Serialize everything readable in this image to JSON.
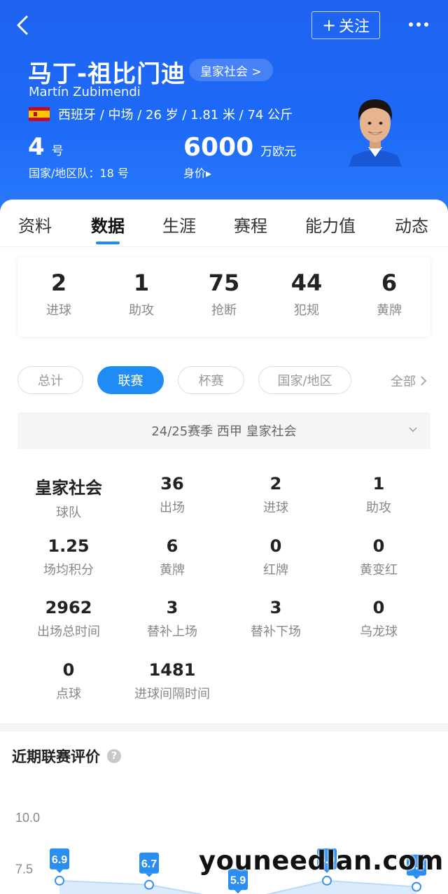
{
  "header": {
    "follow_label": "关注",
    "name_cn": "马丁-祖比门迪",
    "club_chip": "皇家社会 >",
    "name_en": "Martín Zubimendi",
    "bio": "西班牙 / 中场 / 26 岁 / 1.81 米 / 74 公斤",
    "shirt_number": "4",
    "shirt_unit": "号",
    "national_team": "国家/地区队：18 号",
    "market_value": "6000",
    "market_value_unit": "万欧元",
    "market_value_label": "身价▸",
    "colors": {
      "bg": "#1d6af7",
      "accent": "#1f8cf6"
    }
  },
  "tabs": [
    "资料",
    "数据",
    "生涯",
    "赛程",
    "能力值",
    "动态"
  ],
  "active_tab": "数据",
  "summary": [
    {
      "value": "2",
      "label": "进球"
    },
    {
      "value": "1",
      "label": "助攻"
    },
    {
      "value": "75",
      "label": "抢断"
    },
    {
      "value": "44",
      "label": "犯规"
    },
    {
      "value": "6",
      "label": "黄牌"
    }
  ],
  "filters": [
    "总计",
    "联赛",
    "杯赛",
    "国家/地区"
  ],
  "active_filter": "联赛",
  "filter_all": "全部",
  "season_select": "24/25赛季 西甲 皇家社会",
  "stats": [
    {
      "value": "皇家社会",
      "label": "球队"
    },
    {
      "value": "36",
      "label": "出场"
    },
    {
      "value": "2",
      "label": "进球"
    },
    {
      "value": "1",
      "label": "助攻"
    },
    {
      "value": "1.25",
      "label": "场均积分"
    },
    {
      "value": "6",
      "label": "黄牌"
    },
    {
      "value": "0",
      "label": "红牌"
    },
    {
      "value": "0",
      "label": "黄变红"
    },
    {
      "value": "2962",
      "label": "出场总时间"
    },
    {
      "value": "3",
      "label": "替补上场"
    },
    {
      "value": "3",
      "label": "替补下场"
    },
    {
      "value": "0",
      "label": "乌龙球"
    },
    {
      "value": "0",
      "label": "点球"
    },
    {
      "value": "1481",
      "label": "进球间隔时间"
    }
  ],
  "rating": {
    "title": "近期联赛评价",
    "help_icon": "?",
    "chart_data": {
      "type": "area",
      "ylim": [
        2.5,
        10.0
      ],
      "yticks": [
        "10.0",
        "7.5",
        "5.0"
      ],
      "values": [
        6.9,
        6.7,
        5.9,
        6.9,
        6.6
      ],
      "labels": [
        "6.9",
        "6.7",
        "5.9",
        "6.9",
        "6.6"
      ]
    }
  },
  "watermark": "youneedlan.com"
}
